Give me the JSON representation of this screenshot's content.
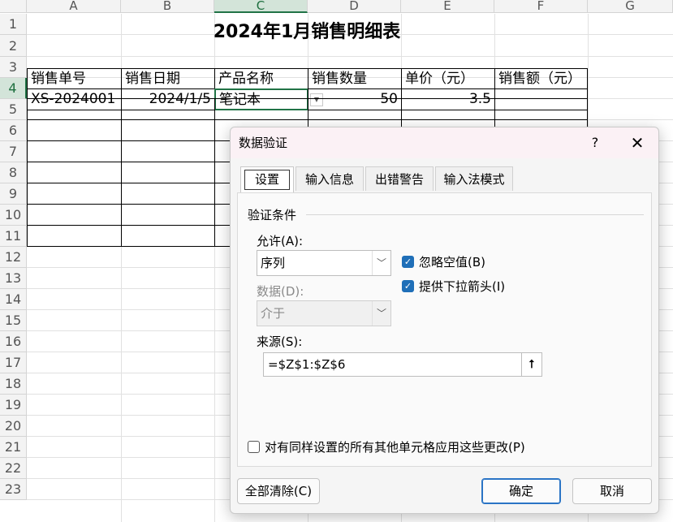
{
  "sheet": {
    "columns": [
      "A",
      "B",
      "C",
      "D",
      "E",
      "F",
      "G"
    ],
    "rows": [
      "1",
      "2",
      "3",
      "4",
      "5",
      "6",
      "7",
      "8",
      "9",
      "10",
      "11",
      "12",
      "13",
      "14",
      "15",
      "16",
      "17",
      "18",
      "19",
      "20",
      "21",
      "22",
      "23"
    ],
    "title": "2024年1月销售明细表",
    "headers": [
      "销售单号",
      "销售日期",
      "产品名称",
      "销售数量",
      "单价（元）",
      "销售额（元）"
    ],
    "row4": [
      "XS-2024001",
      "2024/1/5",
      "笔记本",
      "50",
      "3.5",
      ""
    ],
    "selected_cell": "C4",
    "dropdown_icon": "dropdown-arrow-icon"
  },
  "dialog": {
    "title": "数据验证",
    "help": "?",
    "close": "✕",
    "tabs": [
      "设置",
      "输入信息",
      "出错警告",
      "输入法模式"
    ],
    "active_tab": "设置",
    "group_title": "验证条件",
    "allow_label": "允许(A):",
    "allow_value": "序列",
    "data_label": "数据(D):",
    "data_value": "介于",
    "ignore_blank": {
      "label": "忽略空值(B)",
      "checked": true
    },
    "in_cell_dropdown": {
      "label": "提供下拉箭头(I)",
      "checked": true
    },
    "source_label": "来源(S):",
    "source_value": "=$Z$1:$Z$6",
    "apply_all": {
      "label": "对有同样设置的所有其他单元格应用这些更改(P)",
      "checked": false
    },
    "clear_all": "全部清除(C)",
    "ok": "确定",
    "cancel": "取消"
  },
  "colors": {
    "accent_green": "#217346",
    "checkbox_blue": "#1f6fb8",
    "titlebar": "#fbf1f5"
  }
}
